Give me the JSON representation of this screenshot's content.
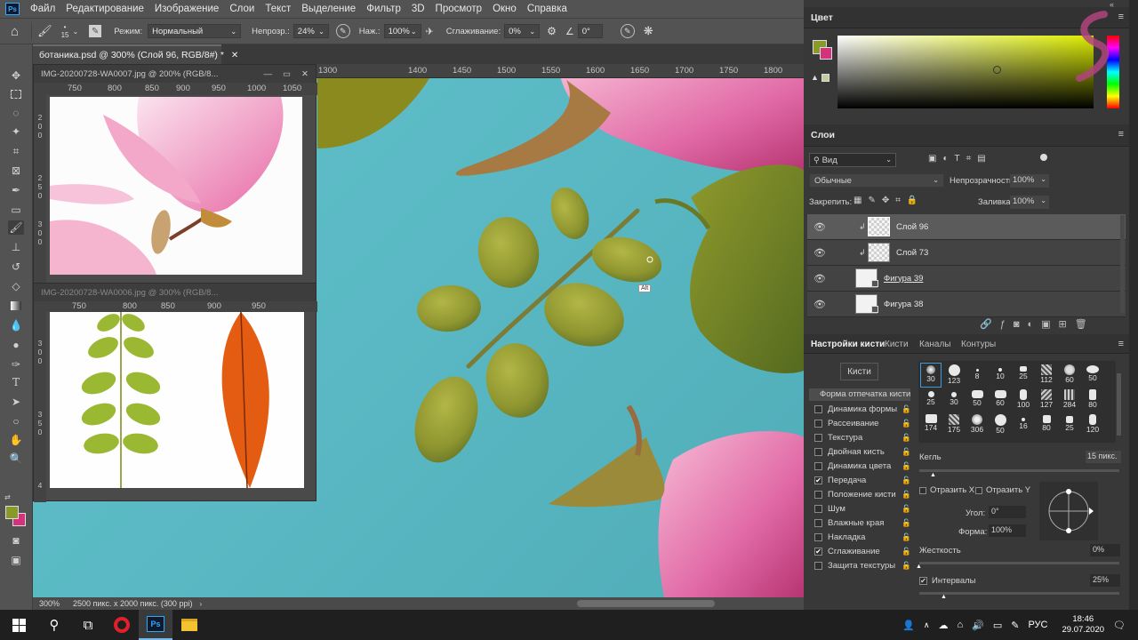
{
  "app": {
    "logo": "Ps"
  },
  "menu": [
    "Файл",
    "Редактирование",
    "Изображение",
    "Слои",
    "Текст",
    "Выделение",
    "Фильтр",
    "3D",
    "Просмотр",
    "Окно",
    "Справка"
  ],
  "options": {
    "brush_size": "15",
    "mode_label": "Режим:",
    "mode_value": "Нормальный",
    "opacity_label": "Непрозр.:",
    "opacity_value": "24%",
    "flow_label": "Наж.:",
    "flow_value": "100%",
    "smoothing_label": "Сглаживание:",
    "smoothing_value": "0%",
    "angle_value": "0°"
  },
  "document_tab": "ботаника.psd @ 300% (Слой 96, RGB/8#) *",
  "float_window_1": {
    "title": "IMG-20200728-WA0007.jpg @ 200% (RGB/8...",
    "ruler": [
      "750",
      "800",
      "850",
      "900",
      "950",
      "1000",
      "1050"
    ],
    "vruler": [
      "2",
      "0",
      "0",
      "2",
      "5",
      "0",
      "3",
      "0",
      "0"
    ]
  },
  "float_window_2": {
    "title": "IMG-20200728-WA0006.jpg @ 300% (RGB/8...",
    "ruler": [
      "750",
      "800",
      "850",
      "900",
      "950"
    ],
    "vruler": [
      "3",
      "0",
      "0",
      "3",
      "5",
      "0",
      "4"
    ]
  },
  "ruler_top": [
    "1300",
    "1400",
    "1450",
    "1500",
    "1550",
    "1600",
    "1650",
    "1700",
    "1750",
    "1800"
  ],
  "status": {
    "zoom": "300%",
    "info": "2500 пикс. x 2000 пикс. (300 ppi)"
  },
  "cursor_tooltip": "Alt",
  "color_panel": {
    "title": "Цвет",
    "fg": "#8a9a2a",
    "bg": "#d4327c",
    "picker_hue": "#dcec00"
  },
  "layers_panel": {
    "title": "Слои",
    "filter": "Вид",
    "blend": "Обычные",
    "opacity_label": "Непрозрачность:",
    "opacity_value": "100%",
    "lock_label": "Закрепить:",
    "fill_label": "Заливка:",
    "fill_value": "100%",
    "layers": [
      {
        "name": "Слой 96",
        "selected": true,
        "clipped": true
      },
      {
        "name": "Слой 73",
        "selected": false,
        "clipped": true
      },
      {
        "name": "Фигура 39",
        "selected": false,
        "clipped": false
      },
      {
        "name": "Фигура 38",
        "selected": false,
        "clipped": false
      }
    ]
  },
  "brush_settings": {
    "tabs": [
      "Настройки кисти",
      "Кисти",
      "Каналы",
      "Контуры"
    ],
    "brushes_button": "Кисти",
    "tip_shape": "Форма отпечатка кисти",
    "options": [
      {
        "label": "Динамика формы",
        "checked": false
      },
      {
        "label": "Рассеивание",
        "checked": false
      },
      {
        "label": "Текстура",
        "checked": false
      },
      {
        "label": "Двойная кисть",
        "checked": false
      },
      {
        "label": "Динамика цвета",
        "checked": false
      },
      {
        "label": "Передача",
        "checked": true
      },
      {
        "label": "Положение кисти",
        "checked": false
      },
      {
        "label": "Шум",
        "checked": false
      },
      {
        "label": "Влажные края",
        "checked": false
      },
      {
        "label": "Накладка",
        "checked": false
      },
      {
        "label": "Сглаживание",
        "checked": true
      },
      {
        "label": "Защита текстуры",
        "checked": false
      }
    ],
    "tips": [
      "30",
      "123",
      "8",
      "10",
      "25",
      "112",
      "60",
      "50",
      "25",
      "30",
      "50",
      "60",
      "100",
      "127",
      "284",
      "80",
      "174",
      "175",
      "306",
      "50",
      "16",
      "80",
      "25",
      "120"
    ],
    "size_label": "Кегль",
    "size_value": "15 пикс.",
    "flip_x": "Отразить X",
    "flip_y": "Отразить Y",
    "angle_label": "Угол:",
    "angle_value": "0°",
    "roundness_label": "Форма:",
    "roundness_value": "100%",
    "hardness_label": "Жесткость",
    "hardness_value": "0%",
    "spacing_label": "Интервалы",
    "spacing_value": "25%"
  },
  "taskbar": {
    "lang": "РУС",
    "time": "18:46",
    "date": "29.07.2020"
  }
}
